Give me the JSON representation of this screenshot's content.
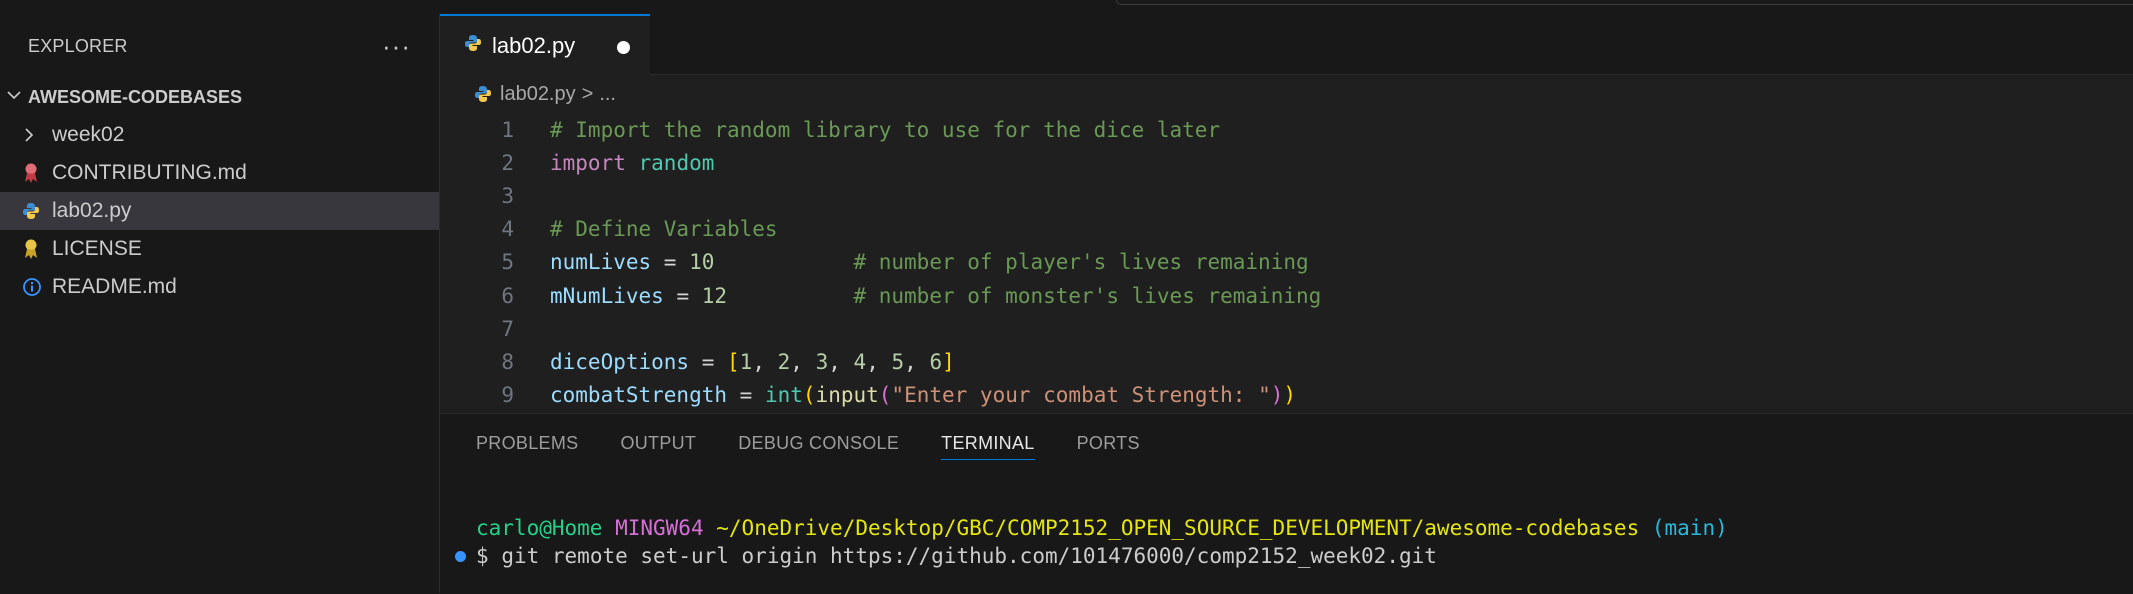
{
  "sidebar": {
    "title": "EXPLORER",
    "more": "···",
    "root": "AWESOME-CODEBASES",
    "items": [
      {
        "label": "week02",
        "type": "folder"
      },
      {
        "label": "CONTRIBUTING.md",
        "type": "contrib"
      },
      {
        "label": "lab02.py",
        "type": "python"
      },
      {
        "label": "LICENSE",
        "type": "license"
      },
      {
        "label": "README.md",
        "type": "info"
      }
    ]
  },
  "editor": {
    "tab": "lab02.py",
    "breadcrumb": {
      "file": "lab02.py",
      "sep": ">",
      "rest": "..."
    },
    "lines": [
      {
        "n": "1",
        "tokens": [
          [
            "comment",
            "# Import the random library to use for the dice later"
          ]
        ]
      },
      {
        "n": "2",
        "tokens": [
          [
            "kw",
            "import"
          ],
          [
            "op",
            " "
          ],
          [
            "mod",
            "random"
          ]
        ]
      },
      {
        "n": "3",
        "tokens": []
      },
      {
        "n": "4",
        "tokens": [
          [
            "comment",
            "# Define Variables"
          ]
        ]
      },
      {
        "n": "5",
        "tokens": [
          [
            "var",
            "numLives"
          ],
          [
            "op",
            " = "
          ],
          [
            "num",
            "10"
          ],
          [
            "op",
            "           "
          ],
          [
            "comment",
            "# number of player's lives remaining"
          ]
        ]
      },
      {
        "n": "6",
        "tokens": [
          [
            "var",
            "mNumLives"
          ],
          [
            "op",
            " = "
          ],
          [
            "num",
            "12"
          ],
          [
            "op",
            "          "
          ],
          [
            "comment",
            "# number of monster's lives remaining"
          ]
        ]
      },
      {
        "n": "7",
        "tokens": []
      },
      {
        "n": "8",
        "tokens": [
          [
            "var",
            "diceOptions"
          ],
          [
            "op",
            " = "
          ],
          [
            "br1",
            "["
          ],
          [
            "num",
            "1"
          ],
          [
            "punc",
            ", "
          ],
          [
            "num",
            "2"
          ],
          [
            "punc",
            ", "
          ],
          [
            "num",
            "3"
          ],
          [
            "punc",
            ", "
          ],
          [
            "num",
            "4"
          ],
          [
            "punc",
            ", "
          ],
          [
            "num",
            "5"
          ],
          [
            "punc",
            ", "
          ],
          [
            "num",
            "6"
          ],
          [
            "br1",
            "]"
          ]
        ]
      },
      {
        "n": "9",
        "tokens": [
          [
            "var",
            "combatStrength"
          ],
          [
            "op",
            " = "
          ],
          [
            "fn-b",
            "int"
          ],
          [
            "br1",
            "("
          ],
          [
            "fn",
            "input"
          ],
          [
            "br2",
            "("
          ],
          [
            "str",
            "\"Enter your combat Strength: \""
          ],
          [
            "br2",
            ")"
          ],
          [
            "br1",
            ")"
          ]
        ]
      }
    ]
  },
  "panel": {
    "tabs": [
      "PROBLEMS",
      "OUTPUT",
      "DEBUG CONSOLE",
      "TERMINAL",
      "PORTS"
    ],
    "active": "TERMINAL",
    "terminal": {
      "user": "carlo@Home",
      "host": "MINGW64",
      "path": "~/OneDrive/Desktop/GBC/COMP2152_OPEN_SOURCE_DEVELOPMENT/awesome-codebases",
      "branch": "(main)",
      "prompt": "$",
      "command": "git remote set-url origin https://github.com/101476000/comp2152_week02.git"
    }
  },
  "colors": {
    "accent": "#0078d4",
    "selection": "#37373d",
    "editor_bg": "#1f1f1f"
  }
}
